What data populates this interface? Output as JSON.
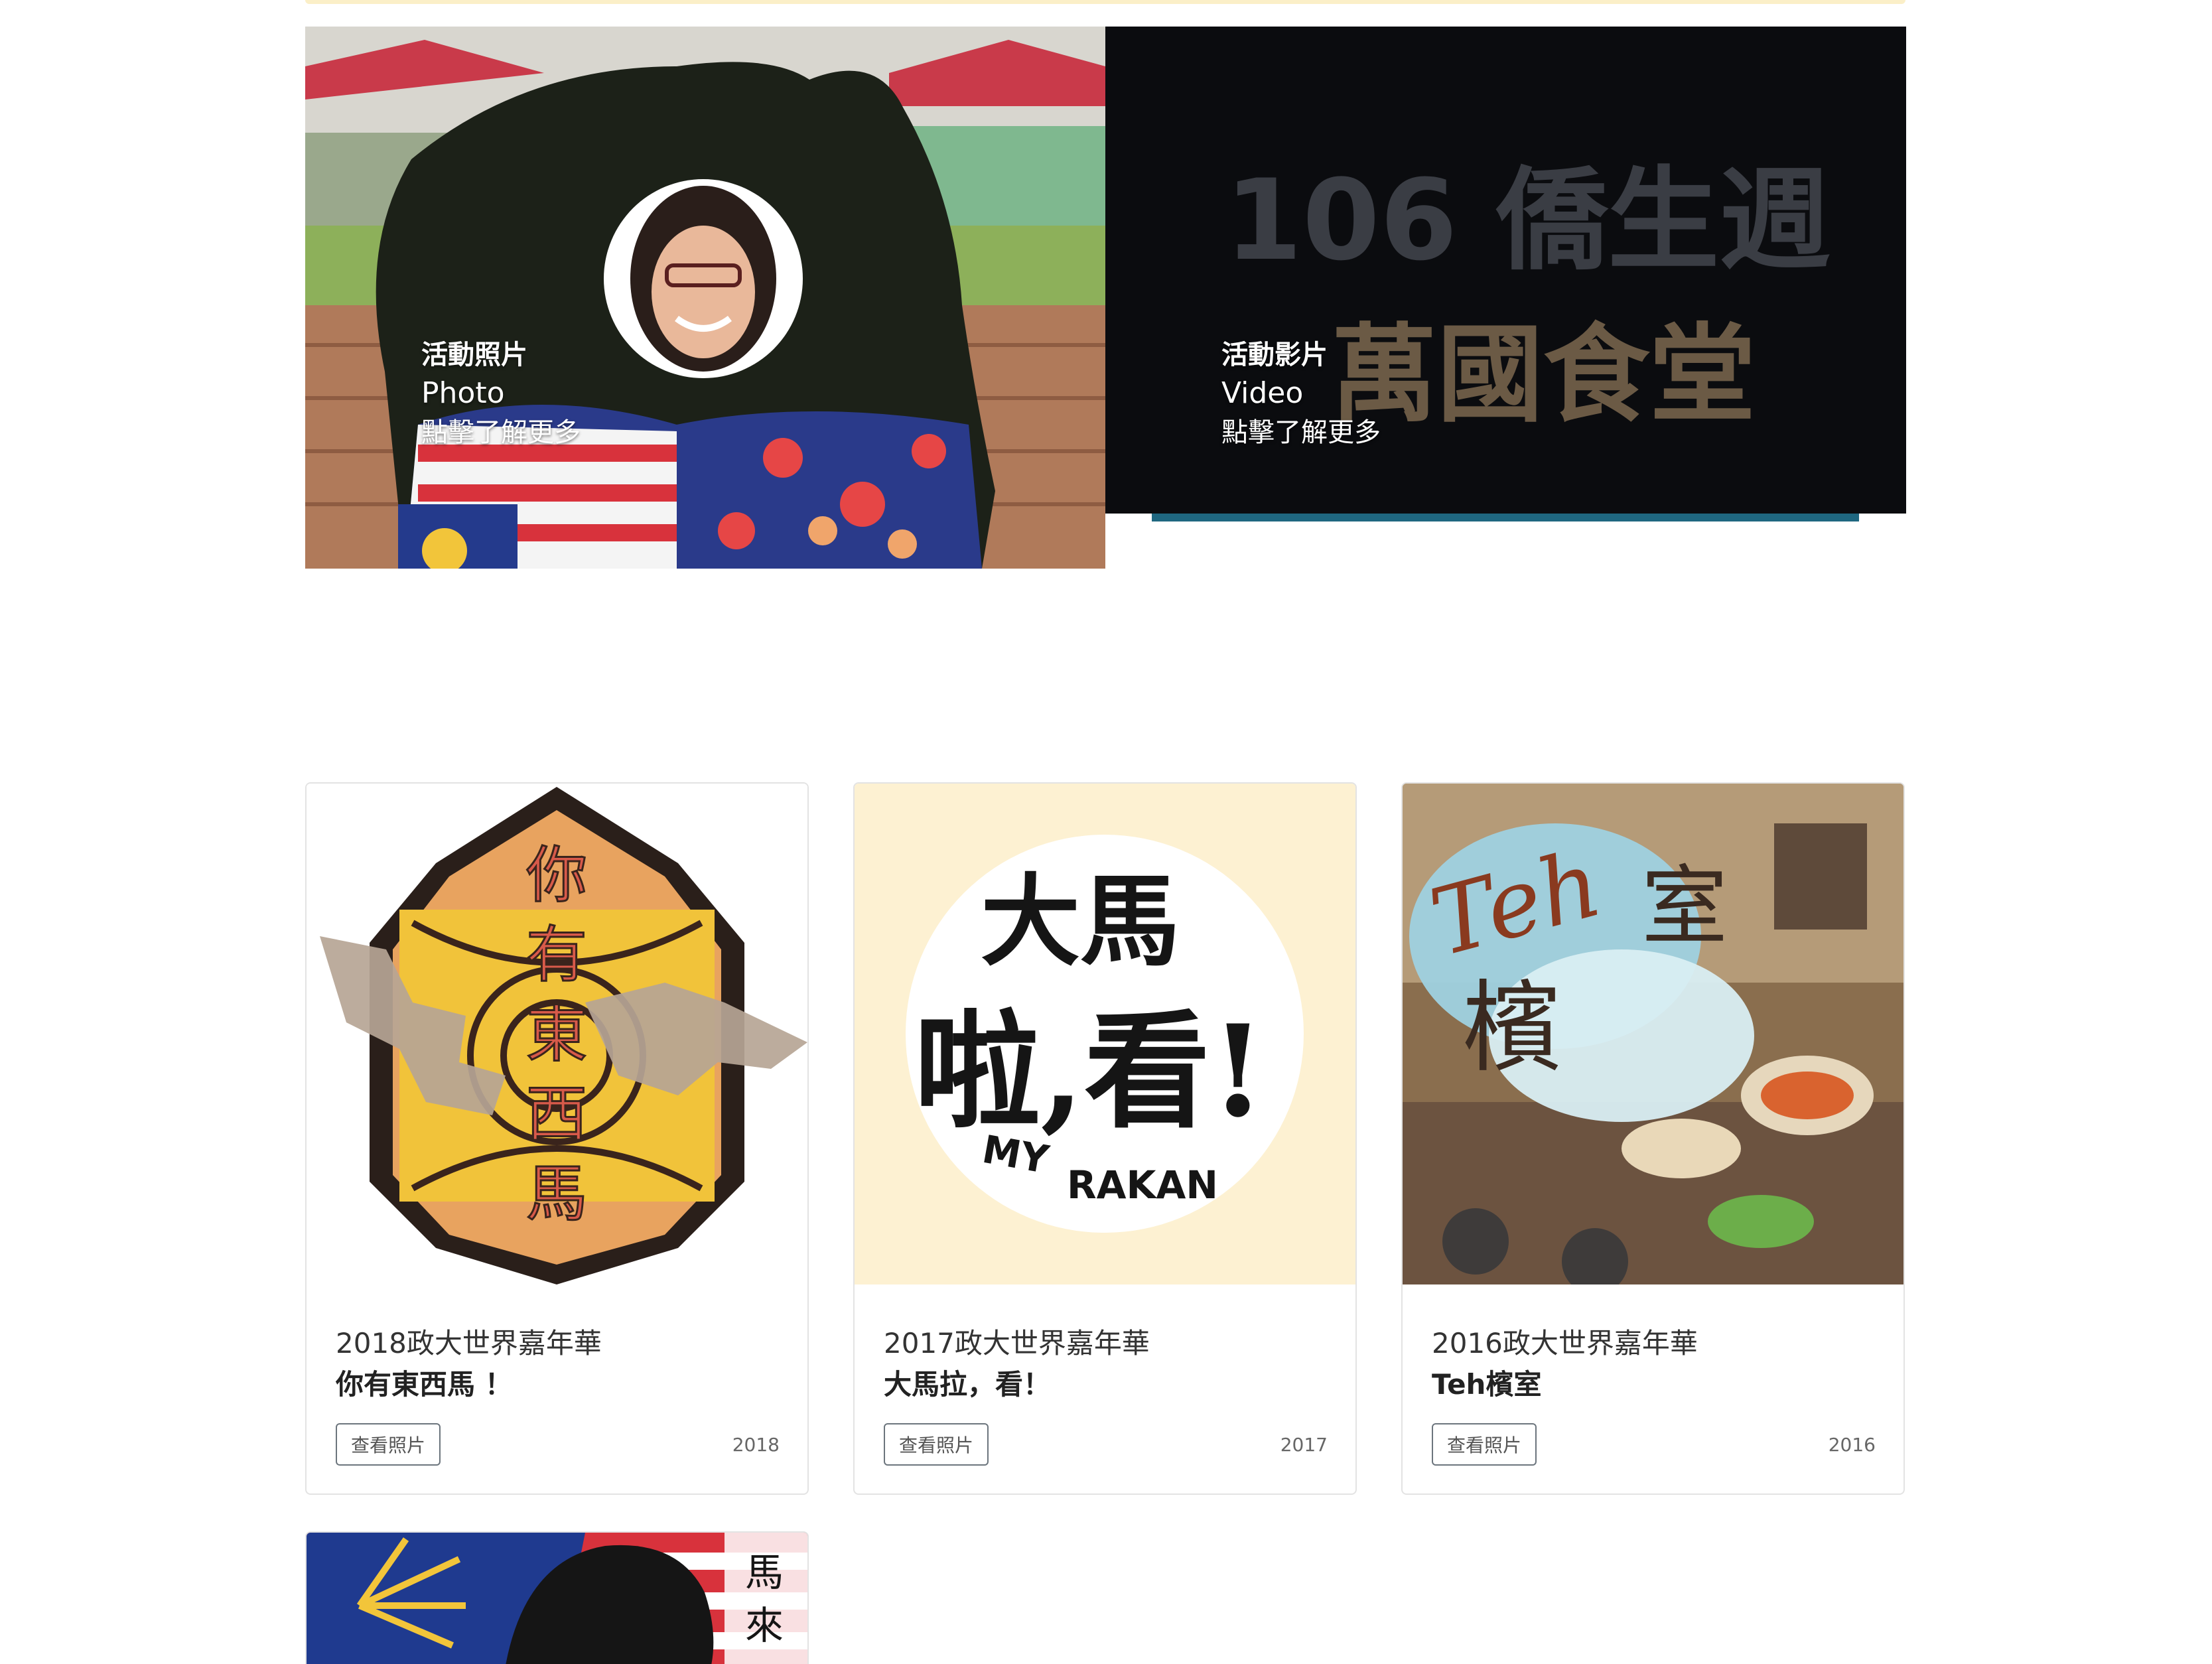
{
  "banners": {
    "photo": {
      "zh": "活動照片",
      "en": "Photo",
      "more": "點擊了解更多"
    },
    "video": {
      "zh": "活動影片",
      "en": "Video",
      "more": "點擊了解更多",
      "art_line1": "106 僑生週",
      "art_line2": "萬國食堂"
    }
  },
  "cards": [
    {
      "event": "2018政大世界嘉年華",
      "title": "你有東西馬 ！",
      "button": "查看照片",
      "year": "2018",
      "art": [
        "你",
        "有",
        "東",
        "西",
        "馬"
      ]
    },
    {
      "event": "2017政大世界嘉年華",
      "title": "大馬拉，看！",
      "button": "查看照片",
      "year": "2017",
      "art": {
        "line1": "大馬",
        "line2": "啦,看!",
        "sub1": "MY",
        "sub2": "RAKAN"
      }
    },
    {
      "event": "2016政大世界嘉年華",
      "title": "Teh檳室",
      "button": "查看照片",
      "year": "2016",
      "art": {
        "latin": "Teh",
        "c1": "檳",
        "c2": "室"
      }
    }
  ],
  "partial_card": {
    "art": [
      "馬",
      "來"
    ]
  },
  "colors": {
    "video_bar": "#1f6780",
    "card_border": "#e3e3e3",
    "top_line": "#fbefc8"
  }
}
